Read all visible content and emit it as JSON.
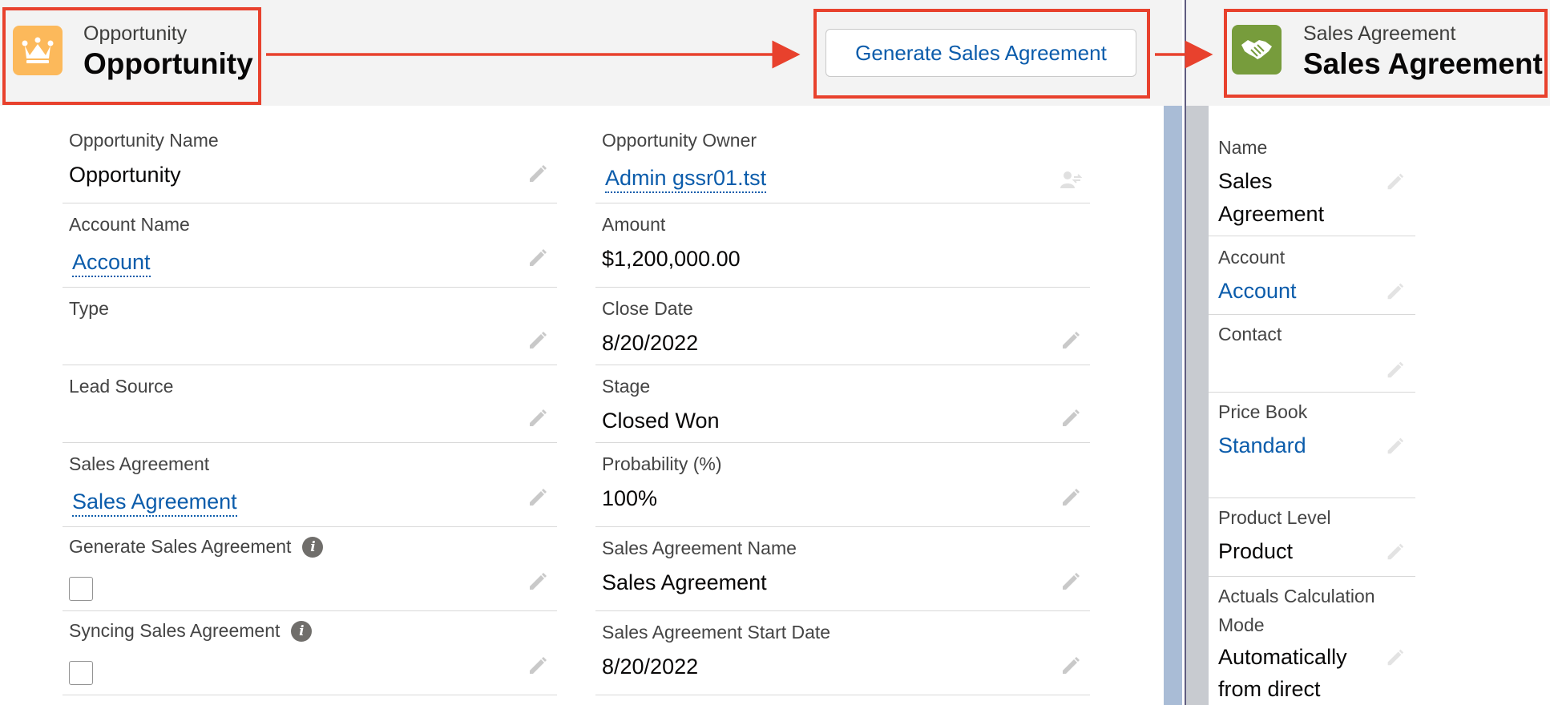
{
  "opportunity": {
    "header": {
      "object_label": "Opportunity",
      "record_name": "Opportunity",
      "icon": "crown-icon",
      "icon_color": "#fcb95b"
    },
    "action_button_label": "Generate Sales Agreement",
    "left_column": [
      {
        "label": "Opportunity Name",
        "value": "Opportunity",
        "type": "text"
      },
      {
        "label": "Account Name",
        "value": "Account",
        "type": "link"
      },
      {
        "label": "Type",
        "value": "",
        "type": "text"
      },
      {
        "label": "Lead Source",
        "value": "",
        "type": "text"
      },
      {
        "label": "Sales Agreement",
        "value": "Sales Agreement",
        "type": "link"
      },
      {
        "label": "Generate Sales Agreement",
        "type": "checkbox",
        "checked": false,
        "info_icon": true
      },
      {
        "label": "Syncing Sales Agreement",
        "type": "checkbox",
        "checked": false,
        "info_icon": true
      }
    ],
    "right_column": [
      {
        "label": "Opportunity Owner",
        "value": "Admin gssr01.tst",
        "type": "link",
        "edit_icon": "change-owner-icon"
      },
      {
        "label": "Amount",
        "value": "$1,200,000.00",
        "type": "text",
        "edit_icon": "none"
      },
      {
        "label": "Close Date",
        "value": "8/20/2022",
        "type": "text"
      },
      {
        "label": "Stage",
        "value": "Closed Won",
        "type": "text"
      },
      {
        "label": "Probability (%)",
        "value": "100%",
        "type": "text"
      },
      {
        "label": "Sales Agreement Name",
        "value": "Sales Agreement",
        "type": "text"
      },
      {
        "label": "Sales Agreement Start Date",
        "value": "8/20/2022",
        "type": "text"
      }
    ]
  },
  "sales_agreement": {
    "header": {
      "object_label": "Sales Agreement",
      "record_name": "Sales Agreement",
      "icon": "handshake-icon",
      "icon_color": "#779c3c"
    },
    "fields": [
      {
        "label": "Name",
        "value_lines": [
          "Sales",
          "Agreement"
        ],
        "type": "text"
      },
      {
        "label": "Account",
        "value_lines": [
          "Account"
        ],
        "type": "link"
      },
      {
        "label": "Contact",
        "value_lines": [],
        "type": "text"
      },
      {
        "label": "Price Book",
        "value_lines": [
          "Standard"
        ],
        "type": "link"
      },
      {
        "label": "Product Level",
        "value_lines": [
          "Product"
        ],
        "type": "text"
      },
      {
        "label_lines": [
          "Actuals Calculation",
          "Mode"
        ],
        "value_lines": [
          "Automatically",
          "from direct"
        ],
        "type": "text"
      }
    ]
  },
  "annotation_color": "#e8412d",
  "link_color": "#0b5cab"
}
